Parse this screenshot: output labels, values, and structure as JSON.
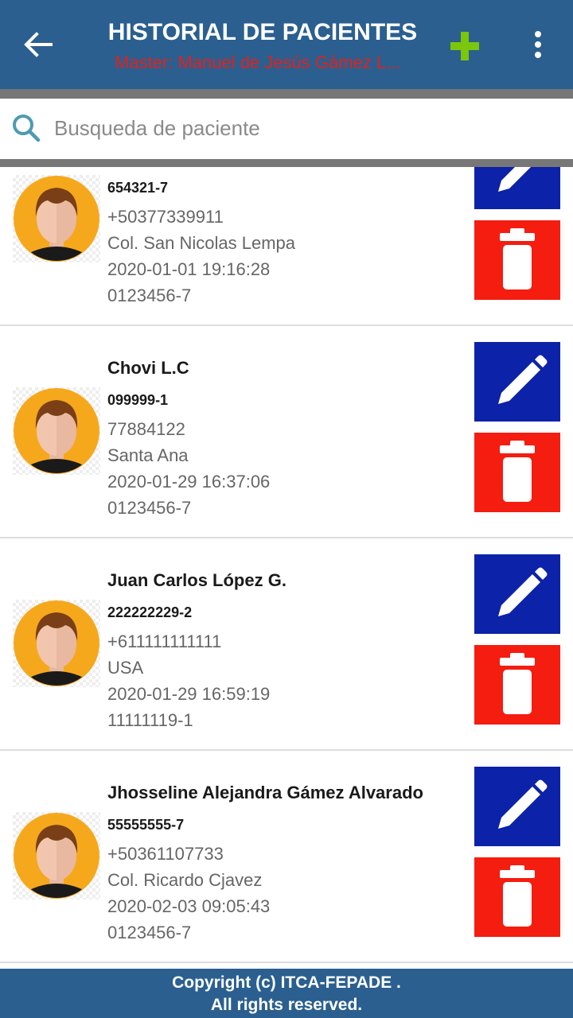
{
  "header": {
    "title": "HISTORIAL DE PACIENTES",
    "subtitle": "Master: Manuel de Jesús Gámez L...",
    "back_icon": "arrow-left-icon",
    "add_icon": "plus-icon",
    "more_icon": "more-vertical-icon",
    "colors": {
      "bar": "#2b5f8f",
      "subtitle": "#e0211d",
      "add": "#7ac70c"
    }
  },
  "search": {
    "placeholder": "Busqueda de paciente",
    "value": "",
    "icon": "search-icon"
  },
  "patients": [
    {
      "name": "",
      "dui": "654321-7",
      "phone": "+50377339911",
      "address": "Col. San Nicolas Lempa",
      "date": "2020-01-01 19:16:28",
      "code": "0123456-7"
    },
    {
      "name": "Chovi L.C",
      "dui": "099999-1",
      "phone": "77884122",
      "address": "Santa Ana",
      "date": "2020-01-29 16:37:06",
      "code": "0123456-7"
    },
    {
      "name": "Juan Carlos López G.",
      "dui": "222222229-2",
      "phone": "+611111111111",
      "address": "USA",
      "date": "2020-01-29 16:59:19",
      "code": "11111119-1"
    },
    {
      "name": "Jhosseline Alejandra Gámez Alvarado",
      "dui": "55555555-7",
      "phone": "+50361107733",
      "address": "Col. Ricardo Cjavez",
      "date": "2020-02-03 09:05:43",
      "code": "0123456-7"
    }
  ],
  "actions": {
    "edit_icon": "pencil-icon",
    "delete_icon": "trash-icon",
    "colors": {
      "edit": "#0c22a8",
      "delete": "#f41d10"
    }
  },
  "footer": {
    "line1": "Copyright (c) ITCA-FEPADE .",
    "line2": "All rights reserved."
  }
}
